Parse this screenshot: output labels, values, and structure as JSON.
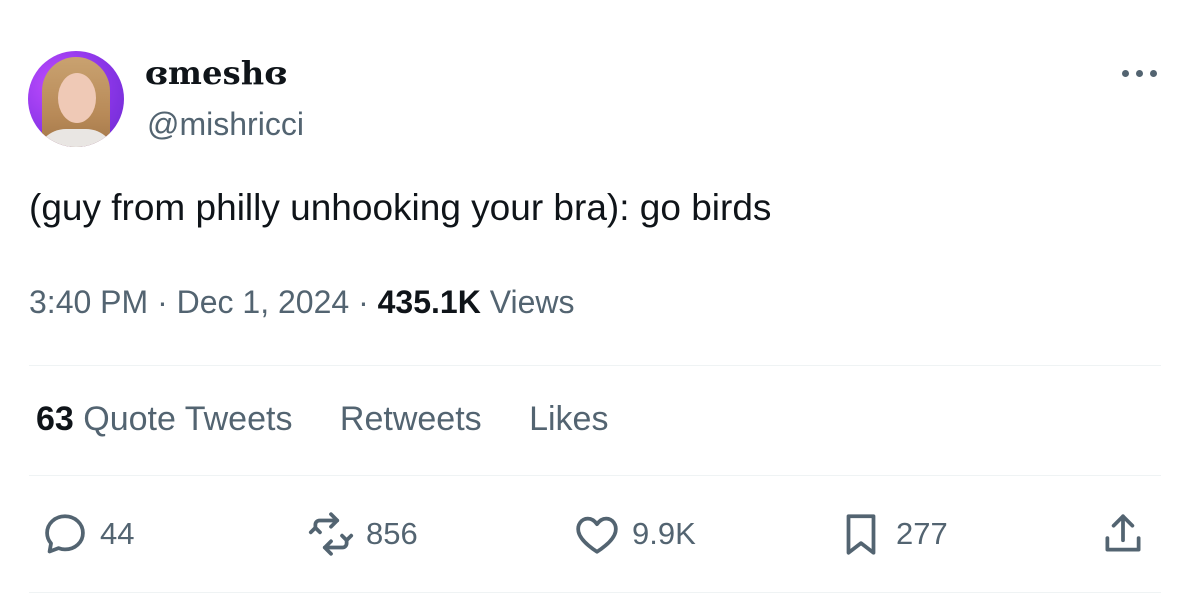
{
  "author": {
    "display_name": "ɞmeshɞ",
    "handle": "@mishricci",
    "avatar_icon": "avatar-photo"
  },
  "tweet": {
    "text": "(guy from philly unhooking your bra): go birds",
    "time": "3:40 PM",
    "date": "Dec 1, 2024",
    "separator": "·",
    "views_count": "435.1K",
    "views_label": "Views"
  },
  "stats": {
    "quote_count": "63",
    "quote_label": "Quote Tweets",
    "retweets_label": "Retweets",
    "likes_label": "Likes"
  },
  "actions": {
    "replies": "44",
    "retweets": "856",
    "likes": "9.9K",
    "bookmarks": "277"
  },
  "colors": {
    "text_primary": "#0f1419",
    "text_secondary": "#536471",
    "divider": "#eff3f4"
  },
  "icons": [
    "more-icon",
    "reply-icon",
    "retweet-icon",
    "like-icon",
    "bookmark-icon",
    "share-icon"
  ]
}
